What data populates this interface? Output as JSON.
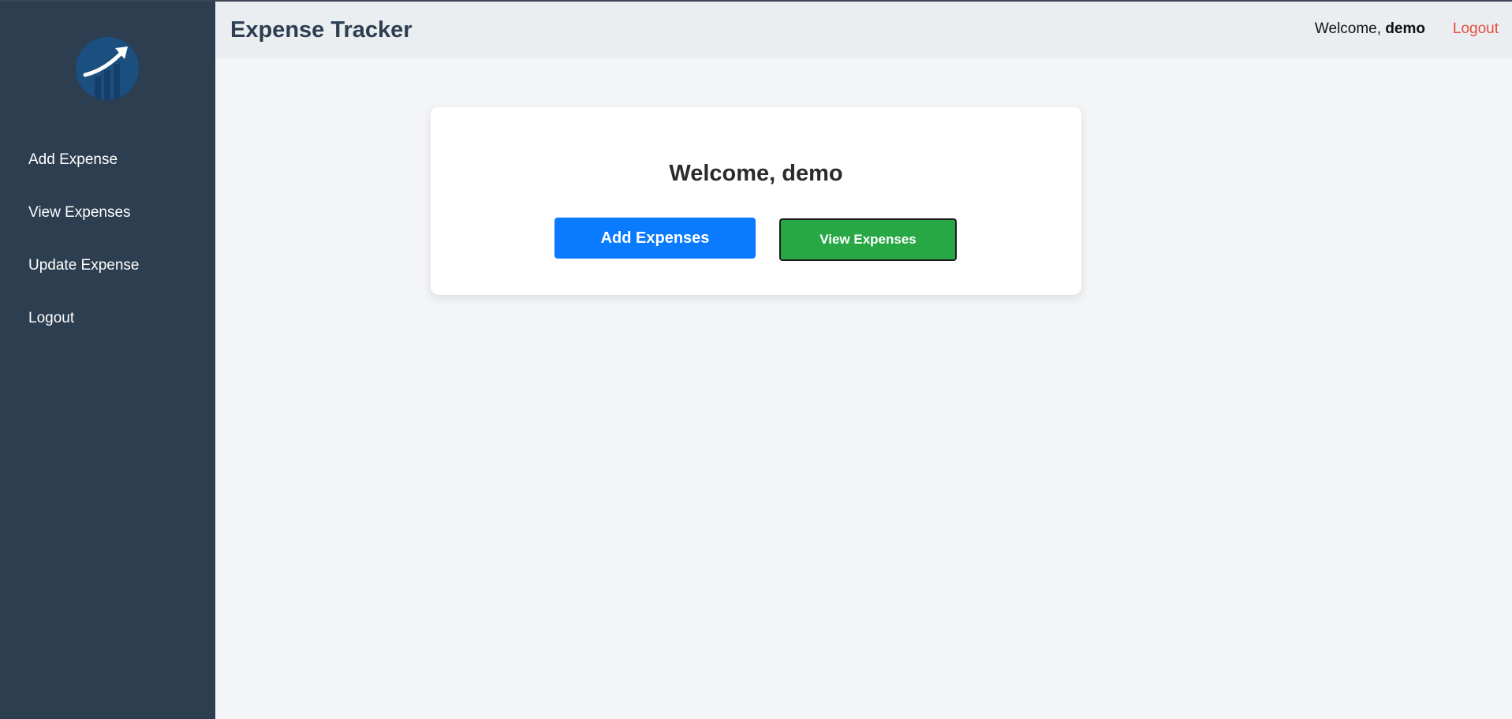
{
  "sidebar": {
    "logo_icon": "trending-up-chart-icon",
    "items": [
      {
        "label": "Add Expense"
      },
      {
        "label": "View Expenses"
      },
      {
        "label": "Update Expense"
      },
      {
        "label": "Logout"
      }
    ]
  },
  "header": {
    "title": "Expense Tracker",
    "welcome_prefix": "Welcome, ",
    "username": "demo",
    "logout_label": "Logout"
  },
  "main": {
    "heading": "Welcome, demo",
    "add_button_label": "Add Expenses",
    "view_button_label": "View Expenses"
  },
  "colors": {
    "sidebar_bg": "#2c3e50",
    "header_bg": "#eaeef0",
    "page_bg": "#f3f5f7",
    "primary_button": "#0a7aff",
    "success_button": "#28a745",
    "logout_link": "#e74c3c"
  }
}
